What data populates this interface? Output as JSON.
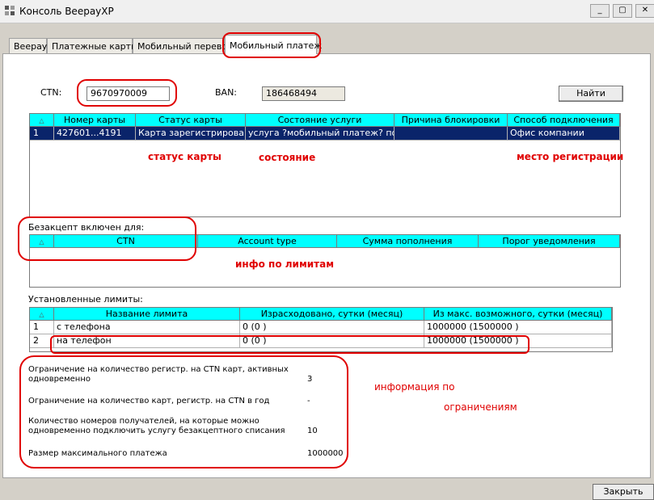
{
  "window": {
    "title": "Консоль BeepayXP"
  },
  "tabs": [
    {
      "label": "Beepay"
    },
    {
      "label": "Платежные карты"
    },
    {
      "label": "Мобильный перевод"
    },
    {
      "label": "Мобильный платеж",
      "active": true
    }
  ],
  "search": {
    "ctn_label": "CTN:",
    "ctn_value": "9670970009",
    "ban_label": "BAN:",
    "ban_value": "186468494",
    "find_label": "Найти"
  },
  "cards_table": {
    "headers": [
      "",
      "Номер карты",
      "Статус карты",
      "Состояние услуги",
      "Причина блокировки",
      "Способ подключения"
    ],
    "rows": [
      {
        "n": "1",
        "card": "427601...4191",
        "status": "Карта зарегистрирована",
        "state": "услуга ?мобильный платеж? по...",
        "reason": "",
        "method": "Офис компании"
      }
    ]
  },
  "accept_section": {
    "title": "Безакцепт включен для:",
    "headers": [
      "",
      "CTN",
      "Account type",
      "Сумма пополнения",
      "Порог уведомления"
    ]
  },
  "limits_section": {
    "title": "Установленные лимиты:",
    "headers": [
      "",
      "Название лимита",
      "Израсходовано, сутки (месяц)",
      "Из макс. возможного, сутки (месяц)"
    ],
    "rows": [
      {
        "n": "1",
        "name": "с телефона",
        "spent": "0 (0 )",
        "max": "1000000 (1500000 )"
      },
      {
        "n": "2",
        "name": "на телефон",
        "spent": "0 (0 )",
        "max": "1000000 (1500000 )"
      }
    ]
  },
  "restrictions": [
    {
      "label": "Ограничение на количество регистр. на CTN карт, активных одновременно",
      "value": "3"
    },
    {
      "label": "Ограничение на количество карт, регистр. на CTN в год",
      "value": "-"
    },
    {
      "label": "Количество номеров получателей, на которые можно одновременно подключить услугу безакцептного списания",
      "value": "10"
    },
    {
      "label": "Размер максимального платежа",
      "value": "1000000"
    }
  ],
  "annotations": {
    "card_status": "статус карты",
    "state": "состояние",
    "registration_place": "место регистрации",
    "limits_info": "инфо по лимитам",
    "restrictions_info_1": "информация по",
    "restrictions_info_2": "ограничениям"
  },
  "footer": {
    "close_label": "Закрыть"
  },
  "colors": {
    "grid_header": "#00ffff",
    "selection": "#0a246a",
    "annotation": "#e00000"
  }
}
